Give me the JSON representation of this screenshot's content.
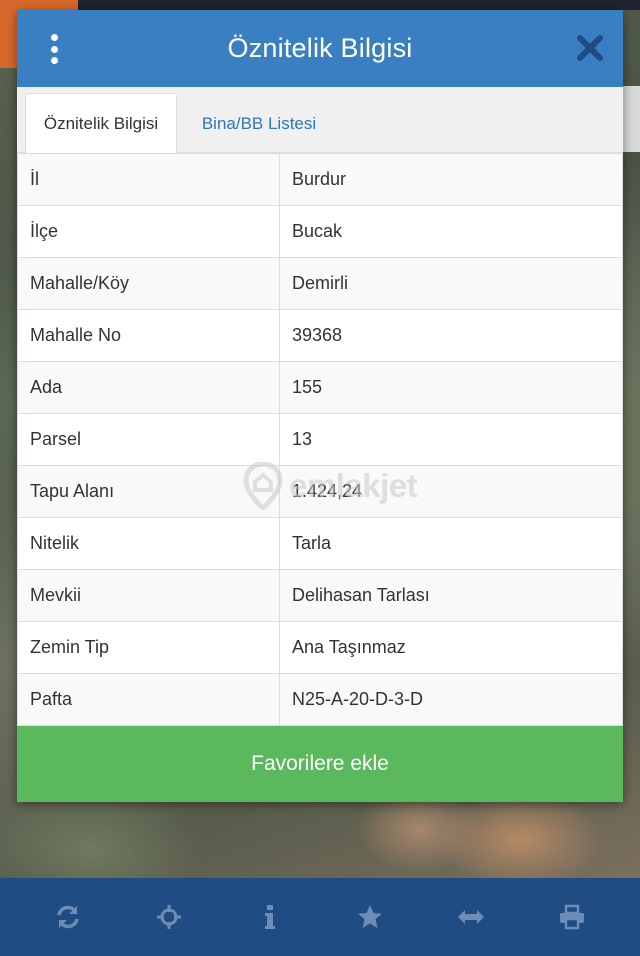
{
  "modal": {
    "title": "Öznitelik Bilgisi",
    "tabs": [
      {
        "label": "Öznitelik Bilgisi",
        "active": true
      },
      {
        "label": "Bina/BB Listesi",
        "active": false
      }
    ],
    "rows": [
      {
        "key": "İl",
        "value": "Burdur"
      },
      {
        "key": "İlçe",
        "value": "Bucak"
      },
      {
        "key": "Mahalle/Köy",
        "value": "Demirli"
      },
      {
        "key": "Mahalle No",
        "value": "39368"
      },
      {
        "key": "Ada",
        "value": "155"
      },
      {
        "key": "Parsel",
        "value": "13"
      },
      {
        "key": "Tapu Alanı",
        "value": "1.424,24"
      },
      {
        "key": "Nitelik",
        "value": "Tarla"
      },
      {
        "key": "Mevkii",
        "value": "Delihasan Tarlası"
      },
      {
        "key": "Zemin Tip",
        "value": "Ana Taşınmaz"
      },
      {
        "key": "Pafta",
        "value": "N25-A-20-D-3-D"
      }
    ],
    "favorite_label": "Favorilere ekle"
  },
  "watermark": {
    "text": "emlakjet"
  },
  "toolbar": {
    "icons": [
      "refresh-icon",
      "crosshair-icon",
      "info-icon",
      "star-icon",
      "arrows-horizontal-icon",
      "print-icon"
    ]
  },
  "colors": {
    "header": "#3a7fc1",
    "toolbar": "#1f4c82",
    "favorite": "#5cb85c",
    "tab_link": "#2e77b8"
  }
}
